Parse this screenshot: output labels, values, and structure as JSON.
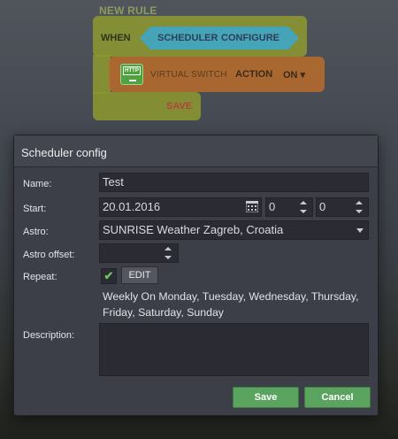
{
  "rule": {
    "title": "NEW RULE",
    "when_label": "WHEN",
    "trigger_module": "SCHEDULER",
    "trigger_action": "CONFIGURE",
    "device_icon": "http-monitor-icon",
    "device_name": "VIRTUAL SWITCH",
    "action_label": "ACTION",
    "action_value": "ON ▾",
    "save_label": "SAVE"
  },
  "dialog": {
    "title": "Scheduler config",
    "name_label": "Name:",
    "name_value": "Test",
    "start_label": "Start:",
    "start_date": "20.01.2016",
    "start_hour": "0",
    "start_minute": "0",
    "astro_label": "Astro:",
    "astro_value": "SUNRISE Weather Zagreb, Croatia",
    "astro_offset_label": "Astro offset:",
    "astro_offset_value": "",
    "repeat_label": "Repeat:",
    "repeat_checked": "✔",
    "edit_label": "EDIT",
    "repeat_summary": "Weekly On Monday, Tuesday, Wednesday, Thursday, Friday, Saturday, Sunday",
    "description_label": "Description:",
    "description_value": "",
    "save_label": "Save",
    "cancel_label": "Cancel"
  },
  "colors": {
    "when_block": "#8e9a2f",
    "action_block": "#b36a2c",
    "scheduler_pill": "#3fa6c8",
    "button_green": "#5aa460"
  }
}
